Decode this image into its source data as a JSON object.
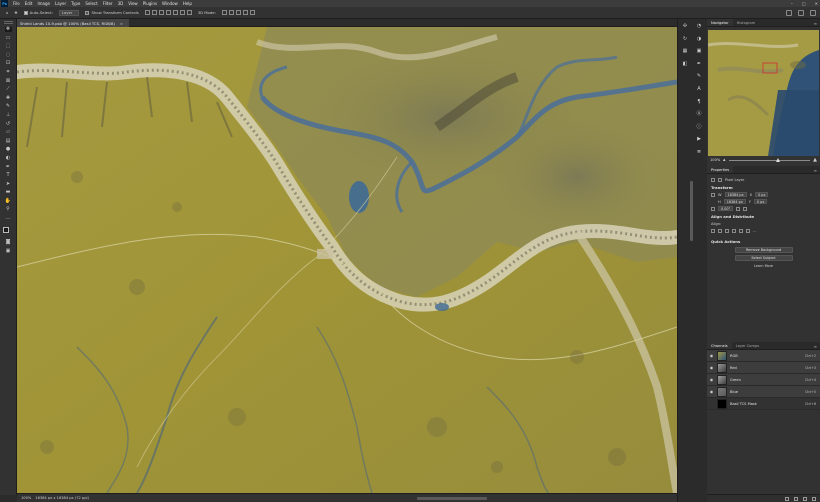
{
  "app": {
    "logo": "Ps"
  },
  "menu": [
    "File",
    "Edit",
    "Image",
    "Layer",
    "Type",
    "Select",
    "Filter",
    "3D",
    "View",
    "Plugins",
    "Window",
    "Help"
  ],
  "window_controls": [
    "–",
    "□",
    "✕"
  ],
  "options_bar": {
    "tool_icon": "move-tool-icon",
    "auto_select_label": "Auto-Select:",
    "auto_select_value": "Layer",
    "show_transform_label": "Show Transform Controls",
    "mode_3d_label": "3D Mode:"
  },
  "document": {
    "tab_title": "Shield Lands 10-9.psb @ 100% (Basil TCS, RGB/8)",
    "close": "×"
  },
  "status": {
    "zoom": "100%",
    "doc_size": "16384 px x 16384 px (72 ppi)"
  },
  "navigator": {
    "tabs": [
      "Navigator",
      "Histogram"
    ],
    "zoom_value": "100%"
  },
  "properties": {
    "tab": "Properties",
    "layer_type": "Pixel Layer",
    "transform": {
      "title": "Transform",
      "w": "16384 px",
      "h": "16384 px",
      "x": "0 px",
      "y": "0 px",
      "angle": "0.00°"
    },
    "align": {
      "title": "Align and Distribute",
      "align_label": "Align:"
    },
    "quick_actions": {
      "title": "Quick Actions",
      "remove_bg": "Remove Background",
      "select_subject": "Select Subject",
      "learn_more": "Learn More"
    }
  },
  "channels": {
    "tabs": [
      "Channels",
      "Layer Comps"
    ],
    "rows": [
      {
        "name": "RGB",
        "shortcut": "Ctrl+2"
      },
      {
        "name": "Red",
        "shortcut": "Ctrl+3"
      },
      {
        "name": "Green",
        "shortcut": "Ctrl+4"
      },
      {
        "name": "Blue",
        "shortcut": "Ctrl+5"
      },
      {
        "name": "Basil TCS Mask",
        "shortcut": "Ctrl+6"
      }
    ]
  },
  "colors": {
    "accent": "#31a8ff",
    "terrain_base": "#9a8f3c",
    "river": "#4a6f9a",
    "mountain": "#d8d2b8"
  }
}
